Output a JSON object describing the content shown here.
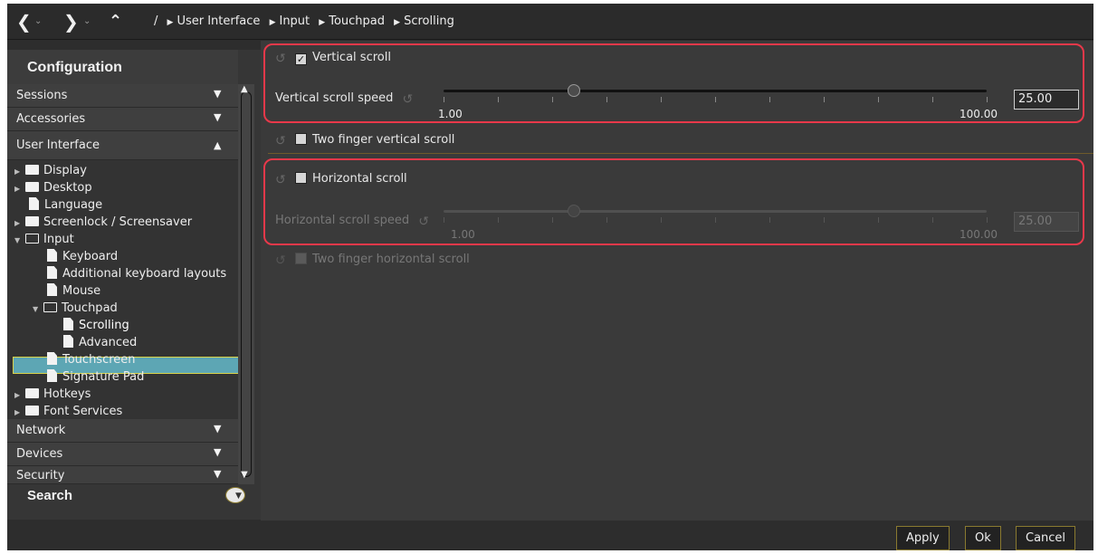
{
  "topbar": {
    "back_icon": "chevron-left-icon",
    "forward_icon": "chevron-right-icon",
    "up_icon": "chevron-up-icon",
    "root": "/",
    "crumbs": [
      "User Interface",
      "Input",
      "Touchpad",
      "Scrolling"
    ]
  },
  "sidebar": {
    "title": "Configuration",
    "categories_top": [
      {
        "label": "Sessions"
      },
      {
        "label": "Accessories"
      },
      {
        "label": "User Interface"
      }
    ],
    "tree": [
      {
        "label": "Display"
      },
      {
        "label": "Desktop"
      },
      {
        "label": "Language"
      },
      {
        "label": "Screenlock / Screensaver"
      },
      {
        "label": "Input"
      },
      {
        "label": "Keyboard"
      },
      {
        "label": "Additional keyboard layouts"
      },
      {
        "label": "Mouse"
      },
      {
        "label": "Touchpad"
      },
      {
        "label": "Scrolling"
      },
      {
        "label": "Advanced"
      },
      {
        "label": "Touchscreen"
      },
      {
        "label": "Signature Pad"
      },
      {
        "label": "Hotkeys"
      },
      {
        "label": "Font Services"
      }
    ],
    "categories_bottom": [
      {
        "label": "Network"
      },
      {
        "label": "Devices"
      },
      {
        "label": "Security"
      }
    ],
    "search": "Search"
  },
  "main": {
    "vertical_scroll": {
      "label": "Vertical scroll",
      "checked": true
    },
    "vertical_speed": {
      "label": "Vertical scroll speed",
      "min": "1.00",
      "max": "100.00",
      "value": "25.00",
      "fraction": 0.24
    },
    "two_finger_vertical": {
      "label": "Two finger vertical scroll",
      "checked": false
    },
    "horizontal_scroll": {
      "label": "Horizontal scroll",
      "checked": false
    },
    "horizontal_speed": {
      "label": "Horizontal scroll speed",
      "min": "1.00",
      "max": "100.00",
      "value": "25.00",
      "fraction": 0.24
    },
    "two_finger_horizontal": {
      "label": "Two finger horizontal scroll",
      "checked": false
    }
  },
  "buttons": {
    "apply": "Apply",
    "ok": "Ok",
    "cancel": "Cancel"
  },
  "colors": {
    "highlight_box": "#e8384a",
    "selection": "#5da6b4",
    "selection_border": "#d9d24a"
  }
}
